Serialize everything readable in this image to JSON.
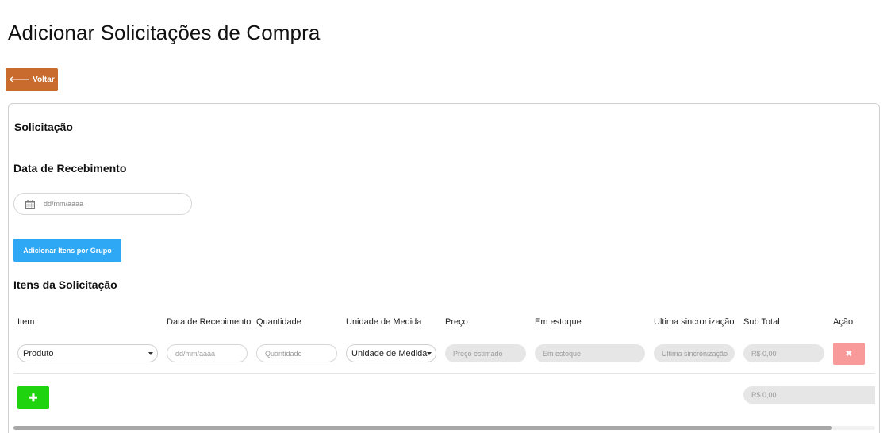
{
  "page_title": "Adicionar Solicitações de Compra",
  "back_button": {
    "icon": "arrow-left-icon",
    "label": "Voltar"
  },
  "form": {
    "section_title": "Solicitação",
    "date_label": "Data de Recebimento",
    "date_placeholder": "dd/mm/aaaa",
    "group_button": "Adicionar Itens por Grupo",
    "items_title": "Itens da Solicitação"
  },
  "table": {
    "headers": [
      "Item",
      "Data de Recebimento",
      "Quantidade",
      "Unidade de Medida",
      "Preço",
      "Em estoque",
      "Ultima sincronização",
      "Sub Total",
      "Ação"
    ],
    "row": {
      "item_value": "Produto",
      "date_placeholder": "dd/mm/aaaa",
      "quantity_placeholder": "Quantidade",
      "unit_value": "Unidade de Medida",
      "price_placeholder": "Preço estimado",
      "stock_placeholder": "Em estoque",
      "sync_placeholder": "Ultima sincronização",
      "subtotal": "R$ 0,00",
      "delete_icon": "close-icon",
      "delete_symbol": "✖"
    },
    "add_symbol": "✚",
    "total": "R$ 0,00"
  },
  "colors": {
    "back_button": "#c96a2e",
    "group_button": "#2ea8f5",
    "delete_button": "#f99a9a",
    "add_button": "#1fd40f"
  },
  "horizontal_scroll_fraction": 0.95
}
